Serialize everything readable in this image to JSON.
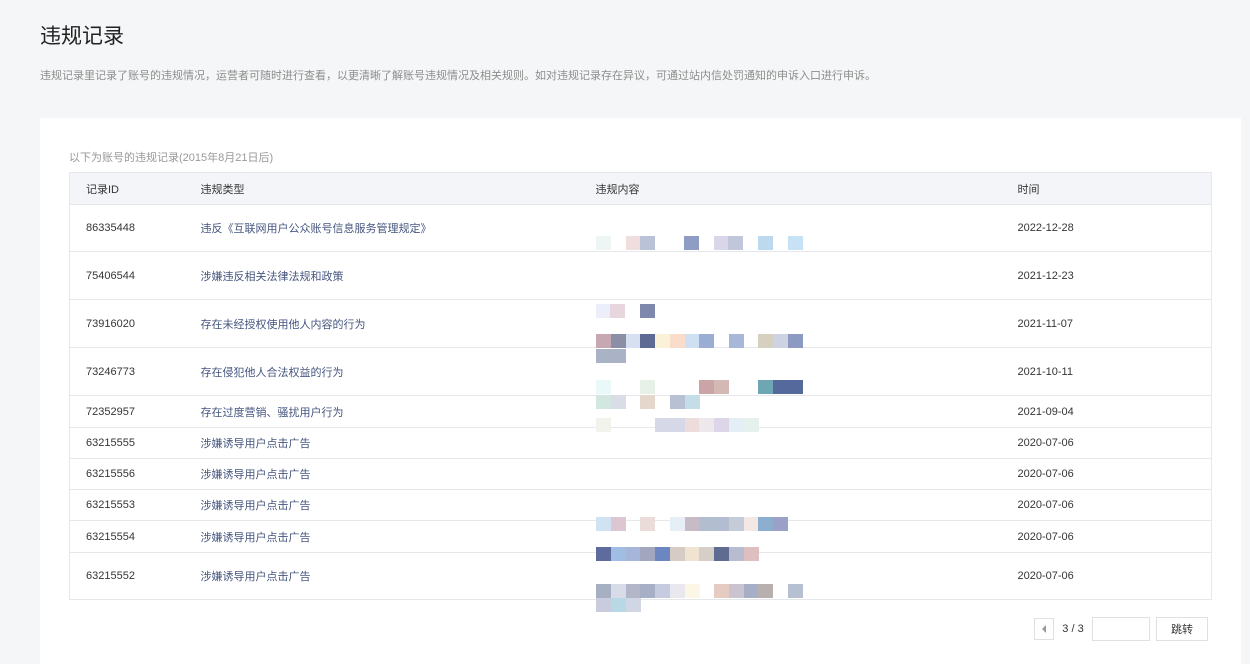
{
  "page": {
    "title": "违规记录",
    "description": "违规记录里记录了账号的违规情况，运营者可随时进行查看，以更清晰了解账号违规情况及相关规则。如对违规记录存在异议，可通过站内信处罚通知的申诉入口进行申诉。"
  },
  "table": {
    "caption": "以下为账号的违规记录(2015年8月21日后)",
    "headers": {
      "id": "记录ID",
      "type": "违规类型",
      "content": "违规内容",
      "time": "时间"
    },
    "rows": [
      {
        "id": "86335448",
        "type": "违反《互联网用户公众账号信息服务管理规定》",
        "time": "2022-12-28"
      },
      {
        "id": "75406544",
        "type": "涉嫌违反相关法律法规和政策",
        "time": "2021-12-23"
      },
      {
        "id": "73916020",
        "type": "存在未经授权使用他人内容的行为",
        "time": "2021-11-07"
      },
      {
        "id": "73246773",
        "type": "存在侵犯他人合法权益的行为",
        "time": "2021-10-11"
      },
      {
        "id": "72352957",
        "type": "存在过度营销、骚扰用户行为",
        "time": "2021-09-04"
      },
      {
        "id": "63215555",
        "type": "涉嫌诱导用户点击广告",
        "time": "2020-07-06"
      },
      {
        "id": "63215556",
        "type": "涉嫌诱导用户点击广告",
        "time": "2020-07-06"
      },
      {
        "id": "63215553",
        "type": "涉嫌诱导用户点击广告",
        "time": "2020-07-06"
      },
      {
        "id": "63215554",
        "type": "涉嫌诱导用户点击广告",
        "time": "2020-07-06"
      },
      {
        "id": "63215552",
        "type": "涉嫌诱导用户点击广告",
        "time": "2020-07-06"
      }
    ]
  },
  "pagination": {
    "info": "3 / 3",
    "input_value": "",
    "jump_label": "跳转"
  },
  "colors": {
    "type_link": "#45557e",
    "header_bg": "#f4f5f9",
    "page_bg": "#f5f6f7"
  }
}
